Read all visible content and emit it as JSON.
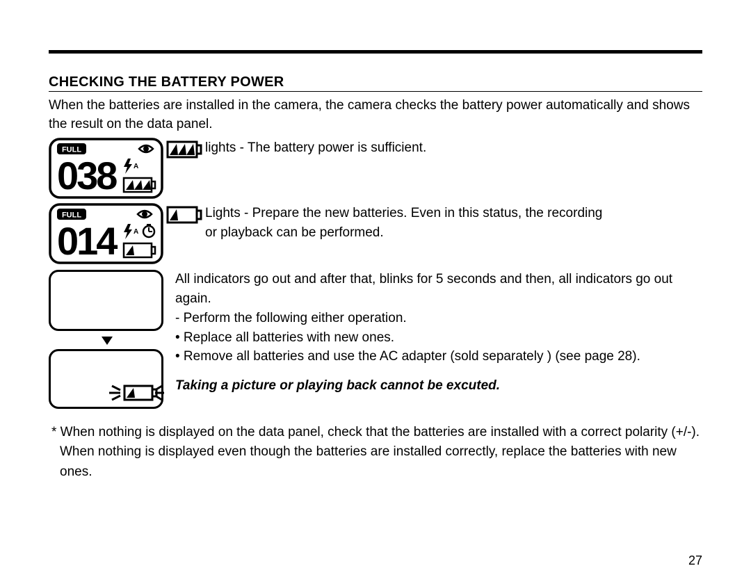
{
  "heading": "CHECKING THE BATTERY POWER",
  "intro": "When the batteries are installed in the camera, the camera checks the battery power automatically and shows the result on the data panel.",
  "panel1": {
    "full_label": "FULL",
    "number": "038",
    "flash_mode": "A",
    "battery_segments": 3
  },
  "panel2": {
    "full_label": "FULL",
    "number": "014",
    "flash_mode": "A",
    "battery_segments": 1,
    "self_timer": true
  },
  "status": {
    "full": {
      "label": "lights - The battery power is sufficient.",
      "icon_segments": 3
    },
    "low": {
      "line1": "Lights - Prepare the new batteries. Even in this status, the recording",
      "line2": " or  playback can be performed.",
      "icon_segments": 1
    },
    "empty": {
      "line1": "All indicators go out and after that, blinks for 5 seconds and then, all indicators go out again.",
      "line2": "- Perform the following either operation.",
      "bullet1": "• Replace all batteries with new ones.",
      "bullet2": "• Remove all batteries and use the AC adapter (sold separately ) (see page 28).",
      "warning": "Taking a picture or playing back cannot be excuted."
    }
  },
  "footnote": "* When nothing is displayed on the data panel, check that the batteries are installed with a correct polarity (+/-). When nothing is displayed even though the batteries are installed correctly, replace the batteries with new ones.",
  "page_number": "27"
}
